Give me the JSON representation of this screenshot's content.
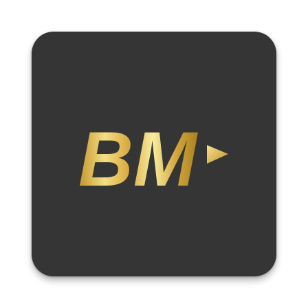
{
  "icon": {
    "logo_text": "BM",
    "background_color": "#353535",
    "accent_colors": [
      "#f8ec9a",
      "#d4a93c",
      "#a77d1e"
    ]
  }
}
